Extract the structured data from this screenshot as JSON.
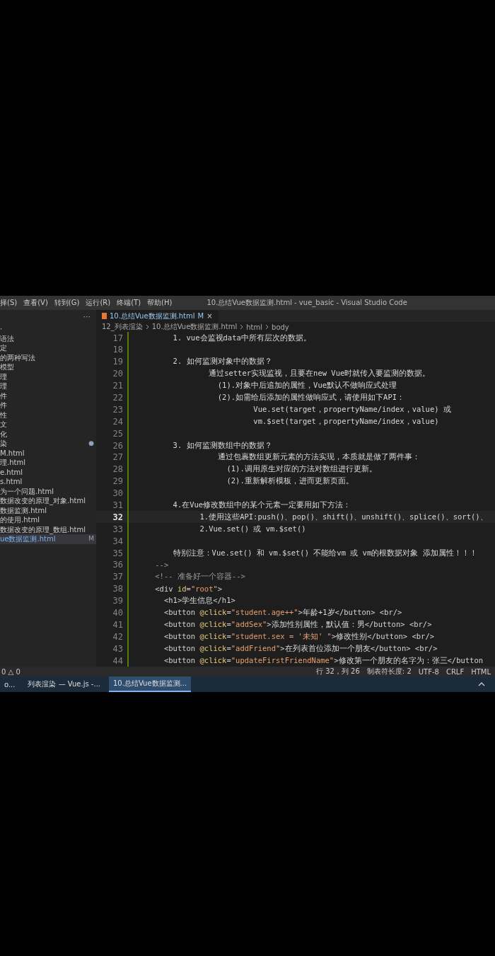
{
  "menu_bar": {
    "items": [
      "择(S)",
      "查看(V)",
      "转到(G)",
      "运行(R)",
      "终端(T)",
      "帮助(H)"
    ],
    "title": "10.总结Vue数据监测.html - vue_basic - Visual Studio Code"
  },
  "sidebar": {
    "more": "···",
    "items": [
      {
        "label": "·",
        "selected": false
      },
      {
        "label": "语法",
        "selected": false
      },
      {
        "label": "定",
        "selected": false
      },
      {
        "label": "的两种写法",
        "selected": false
      },
      {
        "label": "模型",
        "selected": false
      },
      {
        "label": "理",
        "selected": false
      },
      {
        "label": "理",
        "selected": false
      },
      {
        "label": "件",
        "selected": false
      },
      {
        "label": "件",
        "selected": false
      },
      {
        "label": "性",
        "selected": false
      },
      {
        "label": "文",
        "selected": false
      },
      {
        "label": "化",
        "selected": false
      },
      {
        "label": "染",
        "selected": false,
        "badge": "●"
      },
      {
        "label": "M.html",
        "selected": false
      },
      {
        "label": "理.html",
        "selected": false
      },
      {
        "label": "e.html",
        "selected": false
      },
      {
        "label": "s.html",
        "selected": false
      },
      {
        "label": "为一个问题.html",
        "selected": false
      },
      {
        "label": "数据改变的原理_对象.html",
        "selected": false
      },
      {
        "label": "数据监测.html",
        "selected": false
      },
      {
        "label": "的使用.html",
        "selected": false
      },
      {
        "label": "数据改变的原理_数组.html",
        "selected": false
      },
      {
        "label": "ue数据监测.html",
        "selected": true,
        "badge": "M"
      }
    ]
  },
  "tab": {
    "label": "10.总结Vue数据监测.html",
    "status": "M",
    "close": "×",
    "selected": true
  },
  "breadcrumb": [
    "12_列表渲染",
    "10.总结Vue数据监测.html",
    "html",
    "body"
  ],
  "code_lines": [
    {
      "number": "17",
      "current": false,
      "segments": [
        {
          "kind": "text",
          "text": "        1. vue会监视data中所有层次的数据。"
        }
      ]
    },
    {
      "number": "18",
      "current": false
    },
    {
      "number": "19",
      "current": false,
      "segments": [
        {
          "kind": "text",
          "text": "        2. 如何监测对象中的数据？"
        }
      ]
    },
    {
      "number": "20",
      "current": false,
      "segments": [
        {
          "kind": "text",
          "text": "                通过setter实现监视，且要在new Vue时就传入要监测的数据。"
        }
      ]
    },
    {
      "number": "21",
      "current": false,
      "segments": [
        {
          "kind": "text",
          "text": "                  (1).对象中后追加的属性，Vue默认不做响应式处理"
        }
      ]
    },
    {
      "number": "22",
      "current": false,
      "segments": [
        {
          "kind": "text",
          "text": "                  (2).如需给后添加的属性做响应式，请使用如下API："
        }
      ]
    },
    {
      "number": "23",
      "current": false,
      "segments": [
        {
          "kind": "text",
          "text": "                          Vue.set(target，propertyName/index，value) 或"
        }
      ]
    },
    {
      "number": "24",
      "current": false,
      "segments": [
        {
          "kind": "text",
          "text": "                          vm.$set(target，propertyName/index，value)"
        }
      ]
    },
    {
      "number": "25",
      "current": false
    },
    {
      "number": "26",
      "current": false,
      "segments": [
        {
          "kind": "text",
          "text": "        3. 如何监测数组中的数据？"
        }
      ]
    },
    {
      "number": "27",
      "current": false,
      "segments": [
        {
          "kind": "text",
          "text": "                  通过包裹数组更新元素的方法实现，本质就是做了两件事："
        }
      ]
    },
    {
      "number": "28",
      "current": false,
      "segments": [
        {
          "kind": "text",
          "text": "                    (1).调用原生对应的方法对数组进行更新。"
        }
      ]
    },
    {
      "number": "29",
      "current": false,
      "segments": [
        {
          "kind": "text",
          "text": "                    (2).重新解析模板，进而更新页面。"
        }
      ]
    },
    {
      "number": "30",
      "current": false
    },
    {
      "number": "31",
      "current": false,
      "segments": [
        {
          "kind": "text",
          "text": "        4.在Vue修改数组中的某个元素一定要用如下方法："
        }
      ]
    },
    {
      "number": "32",
      "current": true,
      "segments": [
        {
          "kind": "text",
          "text": "              1.使用这些API:push()、pop()、shift()、unshift()、splice()、sort()、"
        }
      ]
    },
    {
      "number": "33",
      "current": false,
      "segments": [
        {
          "kind": "text",
          "text": "              2.Vue.set() 或 vm.$set()"
        }
      ]
    },
    {
      "number": "34",
      "current": false
    },
    {
      "number": "35",
      "current": false,
      "segments": [
        {
          "kind": "text",
          "text": "        特别注意：Vue.set() 和 vm.$set() 不能给vm 或 vm的根数据对象 添加属性！！！"
        }
      ]
    },
    {
      "number": "36",
      "current": false,
      "segments": [
        {
          "kind": "comment",
          "text": "    -->"
        }
      ]
    },
    {
      "number": "37",
      "current": false,
      "segments": [
        {
          "kind": "comment",
          "text": "    <!-- 准备好一个容器-->"
        }
      ]
    },
    {
      "number": "38",
      "current": false,
      "segments": [
        {
          "kind": "tag",
          "text": "    <div "
        },
        {
          "kind": "attr",
          "text": "id"
        },
        {
          "kind": "tag",
          "text": "="
        },
        {
          "kind": "string",
          "text": "\"root\""
        },
        {
          "kind": "tag",
          "text": ">"
        }
      ]
    },
    {
      "number": "39",
      "current": false,
      "segments": [
        {
          "kind": "tag",
          "text": "      <h1>"
        },
        {
          "kind": "text",
          "text": "学生信息"
        },
        {
          "kind": "tag",
          "text": "</h1>"
        }
      ]
    },
    {
      "number": "40",
      "current": false,
      "segments": [
        {
          "kind": "tag",
          "text": "      <button "
        },
        {
          "kind": "attr",
          "text": "@click"
        },
        {
          "kind": "tag",
          "text": "="
        },
        {
          "kind": "string",
          "text": "\"student.age++\""
        },
        {
          "kind": "tag",
          "text": ">"
        },
        {
          "kind": "text",
          "text": "年龄+1岁"
        },
        {
          "kind": "tag",
          "text": "</button> <br/>"
        }
      ]
    },
    {
      "number": "41",
      "current": false,
      "segments": [
        {
          "kind": "tag",
          "text": "      <button "
        },
        {
          "kind": "attr",
          "text": "@click"
        },
        {
          "kind": "tag",
          "text": "="
        },
        {
          "kind": "string",
          "text": "\"addSex\""
        },
        {
          "kind": "tag",
          "text": ">"
        },
        {
          "kind": "text",
          "text": "添加性别属性，默认值：男"
        },
        {
          "kind": "tag",
          "text": "</button> <br/>"
        }
      ]
    },
    {
      "number": "42",
      "current": false,
      "segments": [
        {
          "kind": "tag",
          "text": "      <button "
        },
        {
          "kind": "attr",
          "text": "@click"
        },
        {
          "kind": "tag",
          "text": "="
        },
        {
          "kind": "string",
          "text": "\"student.sex = '未知' \""
        },
        {
          "kind": "tag",
          "text": ">"
        },
        {
          "kind": "text",
          "text": "修改性别"
        },
        {
          "kind": "tag",
          "text": "</button> <br/>"
        }
      ]
    },
    {
      "number": "43",
      "current": false,
      "segments": [
        {
          "kind": "tag",
          "text": "      <button "
        },
        {
          "kind": "attr",
          "text": "@click"
        },
        {
          "kind": "tag",
          "text": "="
        },
        {
          "kind": "string",
          "text": "\"addFriend\""
        },
        {
          "kind": "tag",
          "text": ">"
        },
        {
          "kind": "text",
          "text": "在列表首位添加一个朋友"
        },
        {
          "kind": "tag",
          "text": "</button> <br/>"
        }
      ]
    },
    {
      "number": "44",
      "current": false,
      "segments": [
        {
          "kind": "tag",
          "text": "      <button "
        },
        {
          "kind": "attr",
          "text": "@click"
        },
        {
          "kind": "tag",
          "text": "="
        },
        {
          "kind": "string",
          "text": "\"updateFirstFriendName\""
        },
        {
          "kind": "tag",
          "text": ">"
        },
        {
          "kind": "text",
          "text": "修改第一个朋友的名字为：张三"
        },
        {
          "kind": "tag",
          "text": "</button"
        }
      ]
    }
  ],
  "status_bar": {
    "left": "0 △ 0",
    "items": [
      "行 32，列 26",
      "制表符长度: 2",
      "UTF-8",
      "CRLF",
      "HTML"
    ]
  },
  "taskbar": {
    "items": [
      {
        "label": "o...",
        "selected": false
      },
      {
        "label": "列表渲染 — Vue.js -...",
        "selected": false
      },
      {
        "label": "10.总结Vue数据监测...",
        "selected": true
      }
    ]
  }
}
